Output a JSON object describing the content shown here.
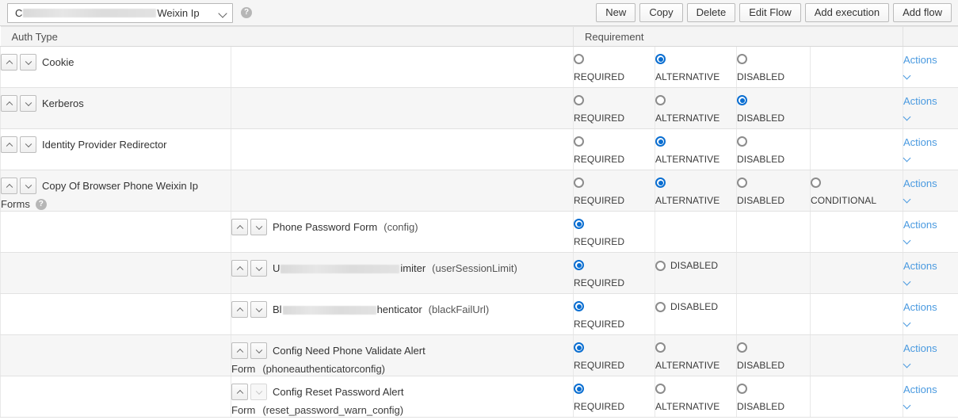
{
  "toolbar": {
    "flow_select": {
      "prefix": "C",
      "suffix": "Weixin Ip",
      "redacted": true,
      "full_label_visible": "C                     Weixin Ip"
    },
    "help_icon": "?",
    "buttons": [
      {
        "label": "New",
        "name": "new-button"
      },
      {
        "label": "Copy",
        "name": "copy-button"
      },
      {
        "label": "Delete",
        "name": "delete-button"
      },
      {
        "label": "Edit Flow",
        "name": "edit-flow-button"
      },
      {
        "label": "Add execution",
        "name": "add-execution-button"
      },
      {
        "label": "Add flow",
        "name": "add-flow-button"
      }
    ]
  },
  "table": {
    "headers": {
      "auth_type": "Auth Type",
      "requirement": "Requirement",
      "blank2": "",
      "blank3": "",
      "blank4": "",
      "blank5": ""
    },
    "actions_label": "Actions",
    "labels": {
      "required": "REQUIRED",
      "alternative": "ALTERNATIVE",
      "disabled": "DISABLED",
      "conditional": "CONDITIONAL"
    },
    "rows": [
      {
        "indent": 0,
        "name": "Cookie",
        "alias": "",
        "subline": "",
        "subline_alias": "",
        "subline_help": false,
        "up_enabled": true,
        "down_enabled": true,
        "options": [
          {
            "key": "REQUIRED",
            "label": "REQUIRED",
            "selected": false,
            "layout": "stack"
          },
          {
            "key": "ALTERNATIVE",
            "label": "ALTERNATIVE",
            "selected": true,
            "layout": "stack"
          },
          {
            "key": "DISABLED",
            "label": "DISABLED",
            "selected": false,
            "layout": "stack"
          },
          {
            "key": "NONE",
            "label": "",
            "selected": null,
            "layout": "empty"
          }
        ]
      },
      {
        "indent": 0,
        "name": "Kerberos",
        "alias": "",
        "subline": "",
        "subline_alias": "",
        "subline_help": false,
        "up_enabled": true,
        "down_enabled": true,
        "options": [
          {
            "key": "REQUIRED",
            "label": "REQUIRED",
            "selected": false,
            "layout": "stack"
          },
          {
            "key": "ALTERNATIVE",
            "label": "ALTERNATIVE",
            "selected": false,
            "layout": "stack"
          },
          {
            "key": "DISABLED",
            "label": "DISABLED",
            "selected": true,
            "layout": "stack"
          },
          {
            "key": "NONE",
            "label": "",
            "selected": null,
            "layout": "empty"
          }
        ]
      },
      {
        "indent": 0,
        "name": "Identity Provider Redirector",
        "alias": "",
        "subline": "",
        "subline_alias": "",
        "subline_help": false,
        "up_enabled": true,
        "down_enabled": true,
        "options": [
          {
            "key": "REQUIRED",
            "label": "REQUIRED",
            "selected": false,
            "layout": "stack"
          },
          {
            "key": "ALTERNATIVE",
            "label": "ALTERNATIVE",
            "selected": true,
            "layout": "stack"
          },
          {
            "key": "DISABLED",
            "label": "DISABLED",
            "selected": false,
            "layout": "stack"
          },
          {
            "key": "NONE",
            "label": "",
            "selected": null,
            "layout": "empty"
          }
        ]
      },
      {
        "indent": 0,
        "name": "Copy Of Browser Phone Weixin Ip",
        "alias": "",
        "subline": "Forms",
        "subline_alias": "",
        "subline_help": true,
        "up_enabled": true,
        "down_enabled": true,
        "options": [
          {
            "key": "REQUIRED",
            "label": "REQUIRED",
            "selected": false,
            "layout": "stack"
          },
          {
            "key": "ALTERNATIVE",
            "label": "ALTERNATIVE",
            "selected": true,
            "layout": "stack"
          },
          {
            "key": "DISABLED",
            "label": "DISABLED",
            "selected": false,
            "layout": "stack"
          },
          {
            "key": "CONDITIONAL",
            "label": "CONDITIONAL",
            "selected": false,
            "layout": "stack"
          }
        ]
      },
      {
        "indent": 1,
        "name": "Phone Password Form",
        "alias": "(config)",
        "subline": "",
        "subline_alias": "",
        "subline_help": false,
        "up_enabled": true,
        "down_enabled": true,
        "options": [
          {
            "key": "REQUIRED",
            "label": "REQUIRED",
            "selected": true,
            "layout": "stack"
          },
          {
            "key": "NONE",
            "label": "",
            "selected": null,
            "layout": "empty"
          },
          {
            "key": "NONE",
            "label": "",
            "selected": null,
            "layout": "empty"
          },
          {
            "key": "NONE",
            "label": "",
            "selected": null,
            "layout": "empty"
          }
        ]
      },
      {
        "indent": 1,
        "name_prefix": "U",
        "name_suffix": "imiter",
        "name_redacted": true,
        "name": "U                   imiter",
        "alias": "(userSessionLimit)",
        "subline": "",
        "subline_alias": "",
        "subline_help": false,
        "up_enabled": true,
        "down_enabled": true,
        "options": [
          {
            "key": "REQUIRED",
            "label": "REQUIRED",
            "selected": true,
            "layout": "stack"
          },
          {
            "key": "DISABLED",
            "label": "DISABLED",
            "selected": false,
            "layout": "inline"
          },
          {
            "key": "NONE",
            "label": "",
            "selected": null,
            "layout": "empty"
          },
          {
            "key": "NONE",
            "label": "",
            "selected": null,
            "layout": "empty"
          }
        ]
      },
      {
        "indent": 1,
        "name_prefix": "Bl",
        "name_suffix": "henticator",
        "name_redacted": true,
        "name": "Bl              henticator",
        "alias": "(blackFailUrl)",
        "subline": "",
        "subline_alias": "",
        "subline_help": false,
        "up_enabled": true,
        "down_enabled": true,
        "options": [
          {
            "key": "REQUIRED",
            "label": "REQUIRED",
            "selected": true,
            "layout": "stack"
          },
          {
            "key": "DISABLED",
            "label": "DISABLED",
            "selected": false,
            "layout": "inline"
          },
          {
            "key": "NONE",
            "label": "",
            "selected": null,
            "layout": "empty"
          },
          {
            "key": "NONE",
            "label": "",
            "selected": null,
            "layout": "empty"
          }
        ]
      },
      {
        "indent": 1,
        "name": "Config Need Phone Validate Alert",
        "alias": "",
        "subline": "Form",
        "subline_alias": "(phoneauthenticatorconfig)",
        "subline_help": false,
        "up_enabled": true,
        "down_enabled": true,
        "options": [
          {
            "key": "REQUIRED",
            "label": "REQUIRED",
            "selected": true,
            "layout": "stack"
          },
          {
            "key": "ALTERNATIVE",
            "label": "ALTERNATIVE",
            "selected": false,
            "layout": "stack"
          },
          {
            "key": "DISABLED",
            "label": "DISABLED",
            "selected": false,
            "layout": "stack"
          },
          {
            "key": "NONE",
            "label": "",
            "selected": null,
            "layout": "empty"
          }
        ]
      },
      {
        "indent": 1,
        "name": "Config Reset Password Alert",
        "alias": "",
        "subline": "Form",
        "subline_alias": "(reset_password_warn_config)",
        "subline_help": false,
        "up_enabled": true,
        "down_enabled": false,
        "options": [
          {
            "key": "REQUIRED",
            "label": "REQUIRED",
            "selected": true,
            "layout": "stack"
          },
          {
            "key": "ALTERNATIVE",
            "label": "ALTERNATIVE",
            "selected": false,
            "layout": "stack"
          },
          {
            "key": "DISABLED",
            "label": "DISABLED",
            "selected": false,
            "layout": "stack"
          },
          {
            "key": "NONE",
            "label": "",
            "selected": null,
            "layout": "empty"
          }
        ]
      }
    ]
  },
  "colors": {
    "accent_blue": "#0a6ed1",
    "link_blue": "#4a9ae0",
    "header_bg": "#f4f4f4",
    "stripe_bg": "#f6f6f6",
    "border": "#e2e2e2"
  }
}
